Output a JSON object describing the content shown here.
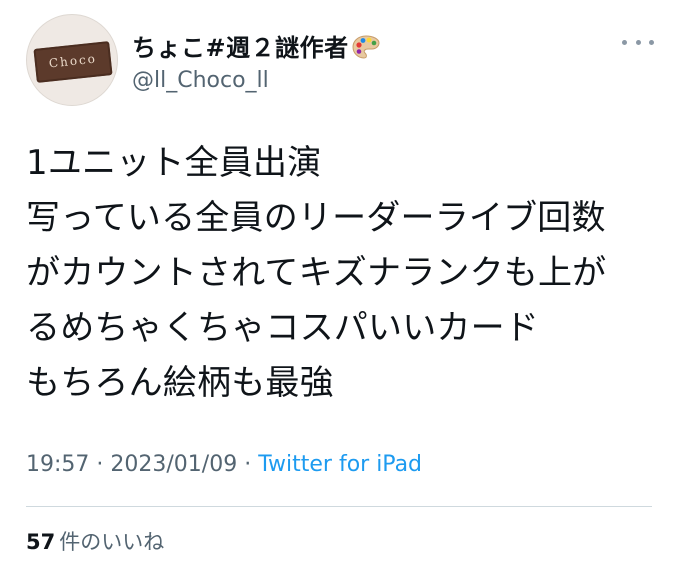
{
  "tweet": {
    "display_name": "ちょこ#週２謎作者",
    "display_name_emoji_icon": "artist-palette-icon",
    "handle": "@ll_Choco_ll",
    "avatar_text": "Choco",
    "lines": [
      "1ユニット全員出演",
      "写っている全員のリーダーライブ回数",
      "がカウントされてキズナランクも上が",
      "るめちゃくちゃコスパいいカード",
      "もちろん絵柄も最強"
    ],
    "time": "19:57",
    "separator": "·",
    "date": "2023/01/09",
    "source": "Twitter for iPad",
    "likes_count": "57",
    "likes_label": "件のいいね"
  },
  "colors": {
    "text": "#0f1419",
    "secondary": "#536471",
    "link": "#1d9bf0",
    "divider": "#cfd9de"
  }
}
